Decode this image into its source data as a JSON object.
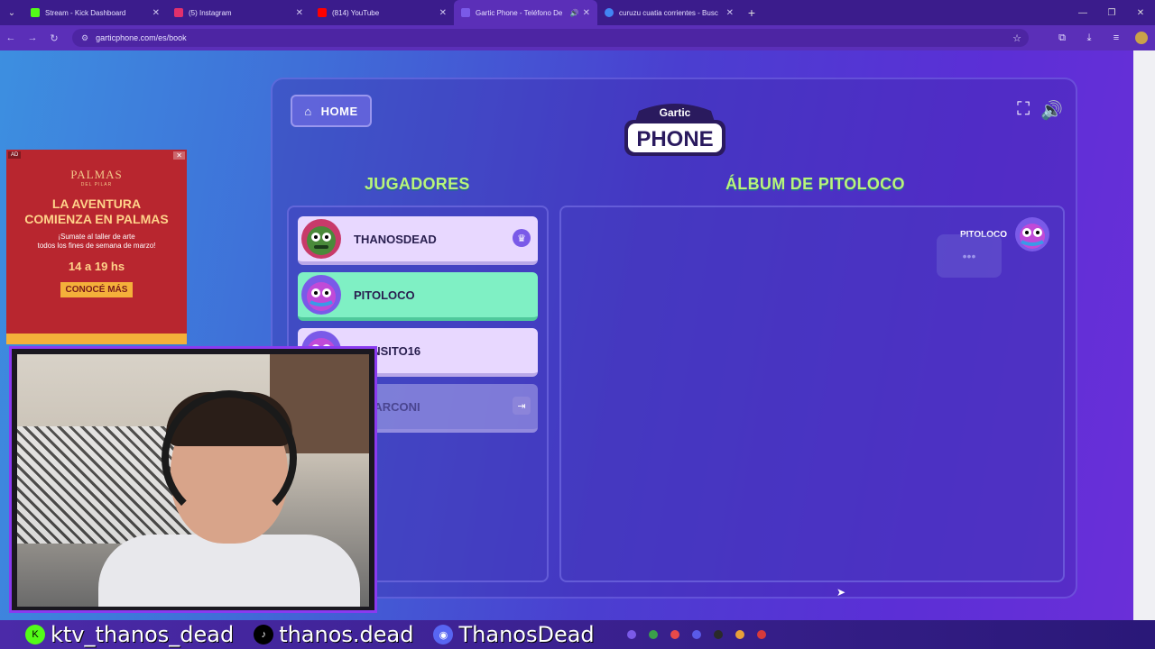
{
  "browser": {
    "tabs": [
      {
        "title": "Stream - Kick Dashboard",
        "fav_color": "#53fc18",
        "active": false
      },
      {
        "title": "(5) Instagram",
        "fav_color": "#e1306c",
        "active": false
      },
      {
        "title": "(814) YouTube",
        "fav_color": "#ff0000",
        "active": false
      },
      {
        "title": "Gartic Phone - Teléfono De",
        "fav_color": "#7a5ae8",
        "active": true
      },
      {
        "title": "curuzu cuatia corrientes - Busc",
        "fav_color": "#4285f4",
        "active": false
      }
    ],
    "url": "garticphone.com/es/book"
  },
  "game": {
    "home_label": "HOME",
    "logo_top": "Gartic",
    "logo_bottom": "PHONE",
    "players_title": "JUGADORES",
    "album_title": "ÁLBUM DE PITOLOCO",
    "players": [
      {
        "name": "THANOSDEAD",
        "state": "normal",
        "badge": "crown-icon"
      },
      {
        "name": "PITOLOCO",
        "state": "current",
        "badge": ""
      },
      {
        "name": "MANSITO16",
        "state": "normal",
        "badge": ""
      },
      {
        "name": "TIMARCONI",
        "state": "faded",
        "badge": "exit-icon"
      }
    ],
    "album_owner": "PITOLOCO",
    "typing_indicator": "•••"
  },
  "ad": {
    "tag": "AD",
    "brand": "PALMAS",
    "brand_sub": "DEL PILAR",
    "headline_1": "LA AVENTURA",
    "headline_2": "COMIENZA EN PALMAS",
    "body_1": "¡Sumate al taller de arte",
    "body_2": "todos los fines de semana de marzo!",
    "hours": "14 a 19 hs",
    "cta": "CONOCÉ MÁS"
  },
  "overlay": {
    "kick_handle": "ktv_thanos_dead",
    "tiktok_handle": "thanos.dead",
    "discord_handle": "ThanosDead"
  },
  "colors": {
    "title_green": "#b8f57a",
    "player_current": "#7ff0c4",
    "player_normal": "#e8d8ff",
    "ad_red": "#b8262f"
  }
}
